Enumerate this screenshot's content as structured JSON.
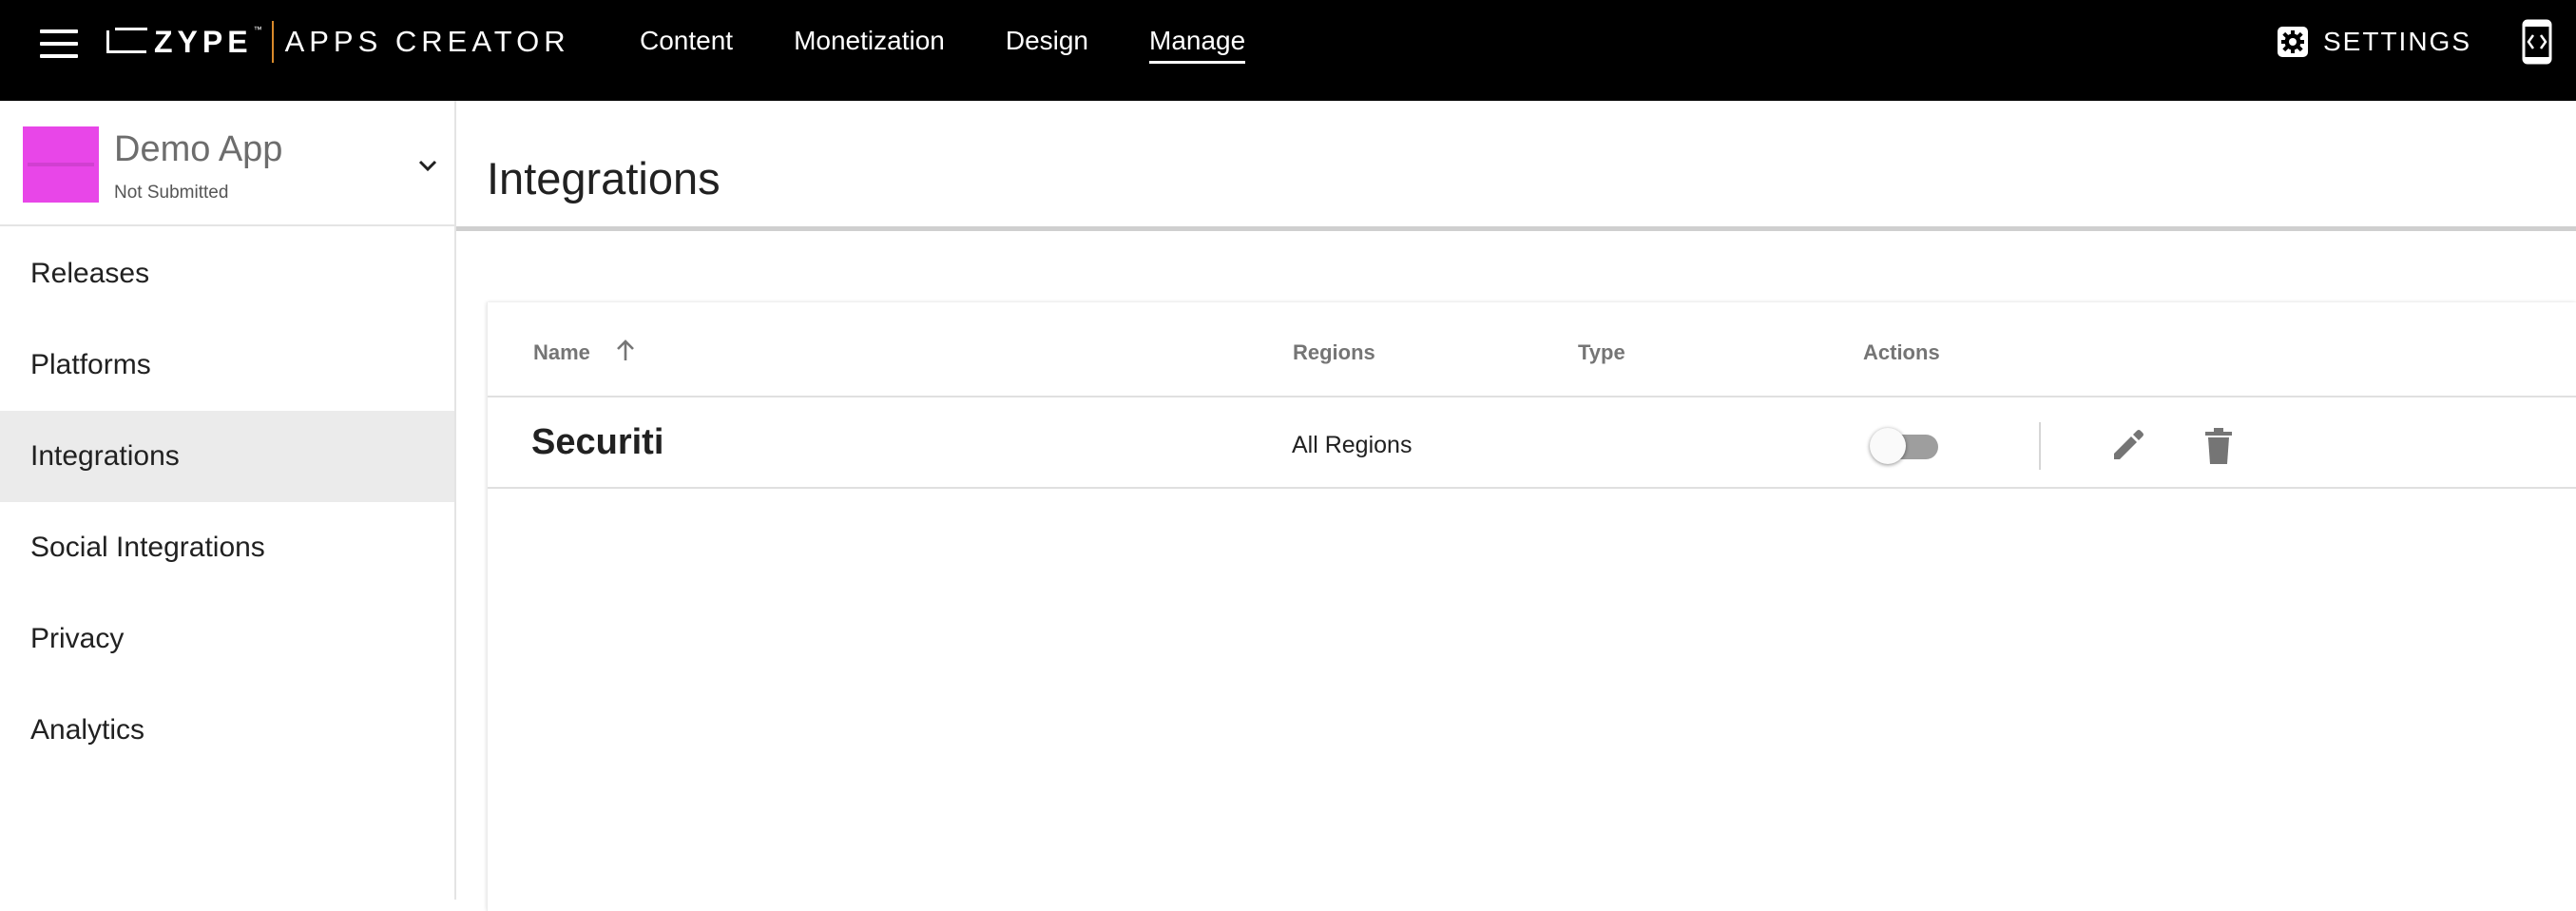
{
  "topbar": {
    "logo_brand": "ZYPE",
    "logo_tm": "™",
    "logo_product": "APPS CREATOR",
    "nav": [
      {
        "label": "Content"
      },
      {
        "label": "Monetization"
      },
      {
        "label": "Design"
      },
      {
        "label": "Manage",
        "active": true
      }
    ],
    "settings_label": "SETTINGS",
    "icons": {
      "menu": "hamburger-menu-icon",
      "settings": "gear-icon",
      "preview": "device-preview-icon"
    }
  },
  "app": {
    "name": "Demo App",
    "status": "Not Submitted",
    "thumb_color": "#e846e8"
  },
  "sidebar": {
    "items": [
      {
        "label": "Releases"
      },
      {
        "label": "Platforms"
      },
      {
        "label": "Integrations",
        "selected": true
      },
      {
        "label": "Social Integrations"
      },
      {
        "label": "Privacy"
      },
      {
        "label": "Analytics"
      }
    ]
  },
  "main": {
    "title": "Integrations",
    "table": {
      "columns": {
        "name": "Name",
        "regions": "Regions",
        "type": "Type",
        "actions": "Actions"
      },
      "sort": {
        "column": "name",
        "direction": "ascending"
      },
      "rows": [
        {
          "name": "Securiti",
          "regions": "All Regions",
          "type": "",
          "enabled": false
        }
      ]
    }
  }
}
